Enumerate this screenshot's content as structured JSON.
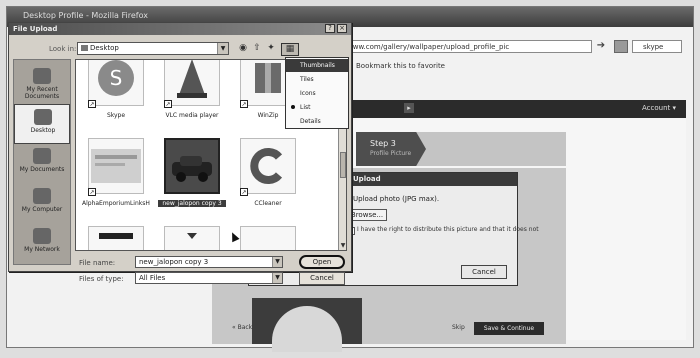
{
  "browser": {
    "title": "Desktop Profile - Mozilla Firefox",
    "address": "www.com/gallery/wallpaper/upload_profile_pic",
    "search_value": "skype",
    "bookmark_text": "Bookmark this to favorite",
    "account_label": "Account ▾"
  },
  "website": {
    "step_title": "Step 3",
    "step_sub": "Profile Picture",
    "upload_modal_title": "Upload",
    "upload_instruction": "Upload photo (JPG max).",
    "browse_label": "Browse...",
    "rights_text": "I have the right to distribute this picture and that it does not",
    "cancel_label": "Cancel",
    "back_label": "« Back",
    "skip_label": "Skip",
    "save_continue_label": "Save & Continue"
  },
  "file_dialog": {
    "title": "File Upload",
    "help_glyph": "?",
    "close_glyph": "×",
    "look_in_label": "Look in:",
    "look_in_value": "Desktop",
    "places": [
      {
        "label": "My Recent Documents"
      },
      {
        "label": "Desktop"
      },
      {
        "label": "My Documents"
      },
      {
        "label": "My Computer"
      },
      {
        "label": "My Network"
      }
    ],
    "files": [
      {
        "name": "Skype",
        "icon": "skype-icon"
      },
      {
        "name": "VLC media player",
        "icon": "vlc-cone-icon"
      },
      {
        "name": "WinZip",
        "icon": "winzip-icon"
      },
      {
        "name": "AlphaEmporiumLinksHD...",
        "icon": "image-thumbnail"
      },
      {
        "name": "new_jalopon copy 3",
        "icon": "car-image-thumbnail"
      },
      {
        "name": "CCleaner",
        "icon": "ccleaner-icon"
      },
      {
        "name": "",
        "icon": "image-thumbnail"
      },
      {
        "name": "",
        "icon": "image-thumbnail"
      },
      {
        "name": "",
        "icon": "image-thumbnail"
      }
    ],
    "file_name_label": "File name:",
    "file_name_value": "new_jalopon copy 3",
    "files_of_type_label": "Files of type:",
    "files_of_type_value": "All Files",
    "open_label": "Open",
    "cancel_label": "Cancel",
    "views_menu": [
      "Thumbnails",
      "Tiles",
      "Icons",
      "List",
      "Details"
    ],
    "views_selected": "List",
    "views_highlighted": "Thumbnails"
  },
  "colors": {
    "dialog_face": "#d4d0c8",
    "selection": "#3c3c3c",
    "site_dark": "#2b2b2b"
  }
}
